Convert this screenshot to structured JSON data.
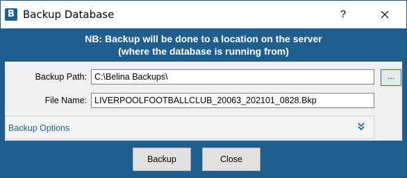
{
  "window": {
    "title": "Backup Database",
    "help_glyph": "?",
    "icon_letter": "B"
  },
  "notice": {
    "line1": "NB: Backup will be done to a location on the server",
    "line2": "(where the database is running from)"
  },
  "form": {
    "backup_path_label": "Backup Path:",
    "backup_path_value": "C:\\Belina Backups\\",
    "browse_label": "...",
    "file_name_label": "File Name:",
    "file_name_value": "LIVERPOOLFOOTBALLCLUB_20063_202101_0828.Bkp"
  },
  "options": {
    "label": "Backup Options"
  },
  "buttons": {
    "backup": "Backup",
    "close": "Close"
  },
  "colors": {
    "accent": "#1f5e8d",
    "panel": "#f0f0f0",
    "browse_border": "#1f6fd0"
  },
  "icons": [
    "app-icon",
    "close-icon",
    "chevron-double-down-icon"
  ]
}
